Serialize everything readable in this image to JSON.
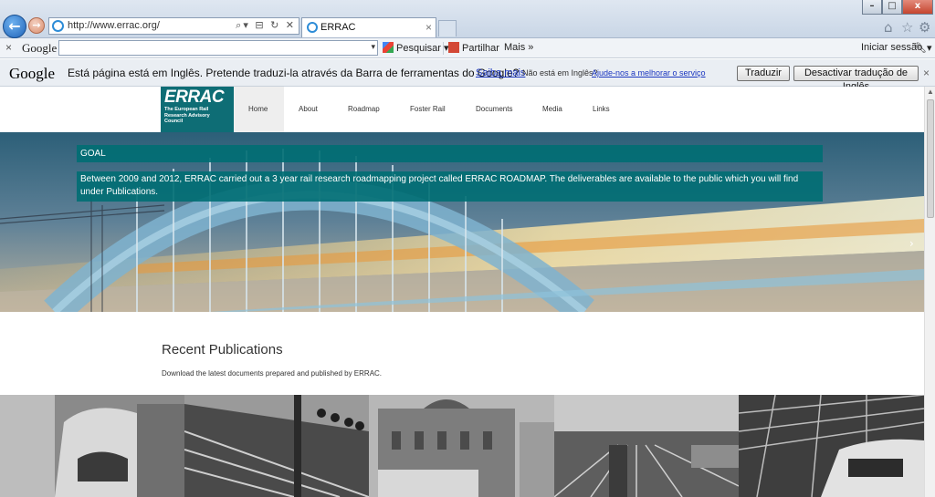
{
  "browser": {
    "url": "http://www.errac.org/",
    "tab_title": "ERRAC",
    "tab_close": "×",
    "back_glyph": "←",
    "forward_glyph": "→",
    "address_tools": "⌕▾ ⊟ ↻ ✕",
    "window_buttons": [
      "–",
      "□",
      "x"
    ],
    "right_icons": [
      "home-icon",
      "star-icon",
      "gear-icon"
    ]
  },
  "google_toolbar": {
    "close": "×",
    "logo": "Google",
    "search_value": "",
    "search_dropdown": "▾",
    "pesquisar": "Pesquisar",
    "partilhar": "Partilhar",
    "mais": "Mais »",
    "iniciar_sessao": "Iniciar sessão"
  },
  "translate_bar": {
    "logo": "Google",
    "message": "Está página está em Inglês.  Pretende traduzi-la através da Barra de ferramentas do Google?",
    "learn_more": "Saiba mais",
    "not_english": "Não está em Inglês?",
    "help_link": "Ajude-nos a melhorar o serviço",
    "translate_button": "Traduzir",
    "disable_button": "Desactivar tradução de Inglês",
    "close": "×"
  },
  "site": {
    "logo_title": "ERRAC",
    "logo_subtitle": "The European Rail Research Advisory Council",
    "nav": [
      "Home",
      "About",
      "Roadmap",
      "Foster Rail",
      "Documents",
      "Media",
      "Links"
    ],
    "active_nav": "Home",
    "hero": {
      "goal_title": "GOAL",
      "goal_text": "Between 2009 and 2012, ERRAC carried out a 3 year rail research roadmapping project called ERRAC ROADMAP. The deliverables are available to the public which you will find under Publications.",
      "next_arrow": "›"
    },
    "recent_title": "Recent Publications",
    "recent_subtitle": "Download the latest documents prepared and published by ERRAC."
  },
  "colors": {
    "teal": "#0e6d75",
    "link": "#1a36c0",
    "ie_blue": "#2d8cd7"
  }
}
